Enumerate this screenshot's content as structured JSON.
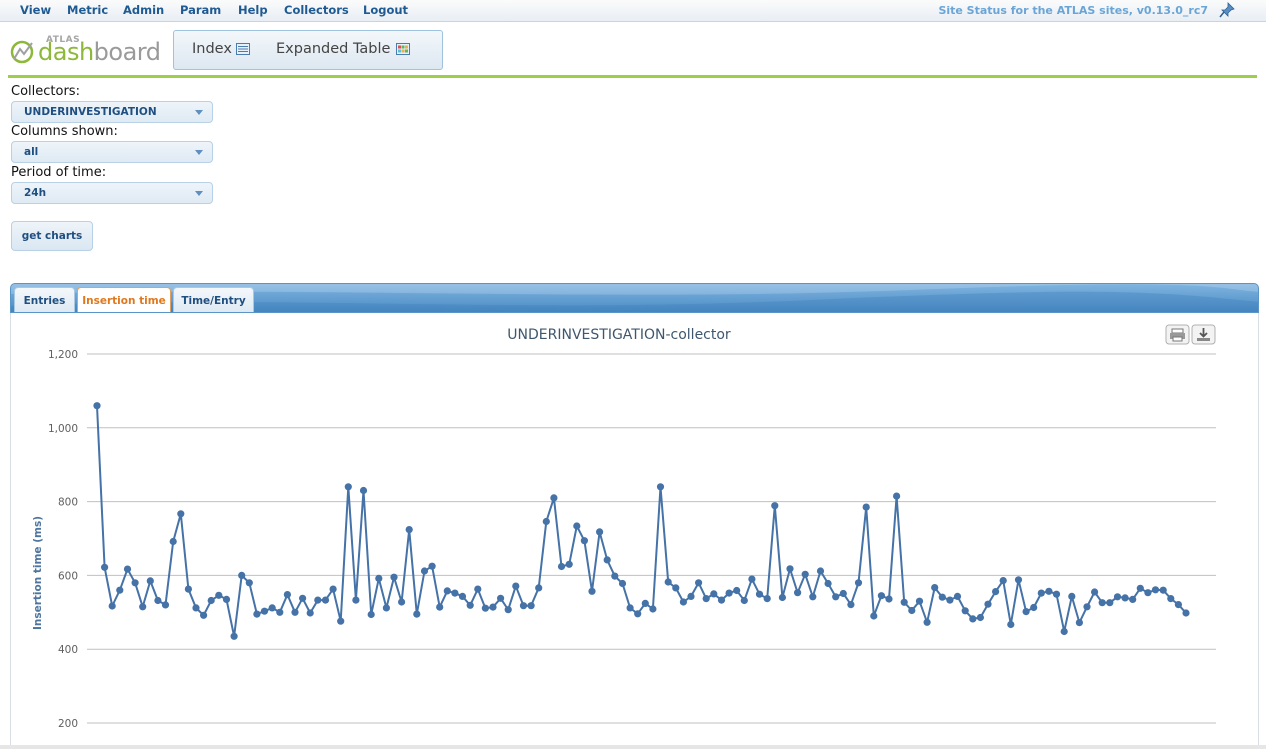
{
  "menu": {
    "items": [
      "View",
      "Metric",
      "Admin",
      "Param",
      "Help",
      "Collectors",
      "Logout"
    ],
    "status": "Site Status for the ATLAS sites, v0.13.0_rc7"
  },
  "logo": {
    "atlas": "ATLAS",
    "dash": "dash",
    "board": "board"
  },
  "nav": {
    "index": "Index",
    "expanded": "Expanded Table"
  },
  "form": {
    "collectors_label": "Collectors:",
    "collectors_value": "UNDERINVESTIGATION",
    "columns_label": "Columns shown:",
    "columns_value": "all",
    "period_label": "Period of time:",
    "period_value": "24h",
    "get_charts": "get charts"
  },
  "tabs": [
    "Entries",
    "Insertion time",
    "Time/Entry"
  ],
  "active_tab": "Insertion time",
  "colors": {
    "accent": "#e0781c",
    "line": "#4572a7",
    "brand_green": "#9fcf4a"
  },
  "icons": [
    "pin-icon",
    "index-icon",
    "table-icon",
    "print-icon",
    "export-icon"
  ],
  "chart_data": {
    "type": "line",
    "title": "UNDERINVESTIGATION-collector",
    "ylabel": "Insertion time (ms)",
    "xlabel": "",
    "ylim": [
      200,
      1200
    ],
    "yticks": [
      200,
      400,
      600,
      800,
      1000,
      1200
    ],
    "ytick_labels": [
      "200",
      "400",
      "600",
      "800",
      "1,000",
      "1,200"
    ],
    "grid": true,
    "legend": "none",
    "values": [
      1060,
      622,
      517,
      560,
      617,
      580,
      515,
      585,
      532,
      520,
      692,
      767,
      563,
      512,
      492,
      532,
      546,
      535,
      435,
      600,
      580,
      495,
      503,
      512,
      500,
      548,
      500,
      538,
      498,
      533,
      533,
      563,
      476,
      840,
      533,
      830,
      494,
      592,
      512,
      595,
      528,
      724,
      495,
      612,
      625,
      514,
      558,
      552,
      543,
      519,
      563,
      511,
      514,
      538,
      507,
      571,
      518,
      518,
      566,
      746,
      810,
      624,
      630,
      734,
      694,
      557,
      718,
      642,
      598,
      578,
      512,
      496,
      524,
      509,
      840,
      582,
      566,
      528,
      543,
      580,
      537,
      550,
      533,
      552,
      559,
      532,
      590,
      549,
      537,
      789,
      540,
      618,
      553,
      603,
      542,
      612,
      578,
      542,
      551,
      521,
      580,
      785,
      490,
      545,
      536,
      815,
      527,
      505,
      530,
      473,
      567,
      541,
      533,
      543,
      504,
      482,
      486,
      522,
      556,
      586,
      467,
      588,
      502,
      513,
      552,
      557,
      549,
      448,
      543,
      472,
      515,
      555,
      526,
      526,
      542,
      539,
      535,
      565,
      553,
      561,
      560,
      537,
      521,
      498
    ]
  }
}
